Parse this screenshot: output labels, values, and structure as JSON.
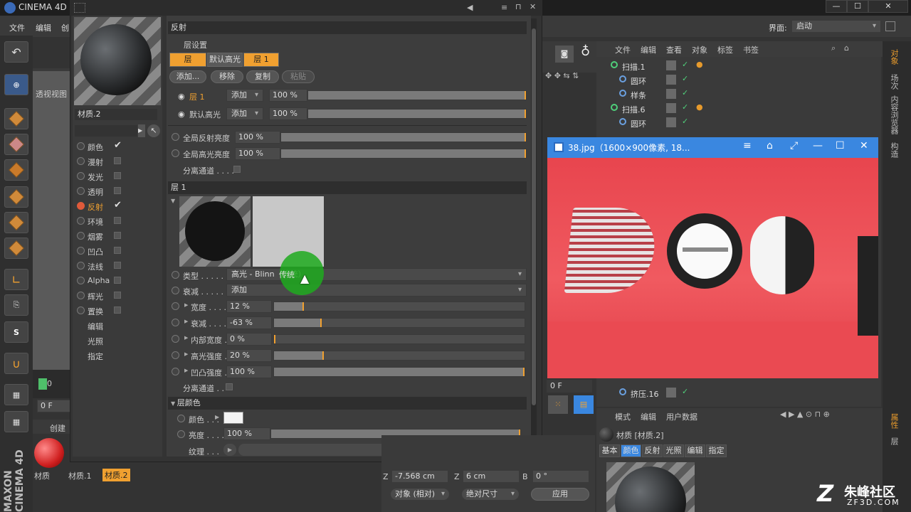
{
  "app": {
    "title": "CINEMA 4D",
    "menus": [
      "文件",
      "编辑",
      "创"
    ],
    "layout_label": "界面:",
    "layout_value": "启动"
  },
  "viewport": {
    "tab": "查看",
    "view_label": "透视视图",
    "frame_top": "0",
    "frame_field": "0 F"
  },
  "material_editor": {
    "preview_name": "材质.2",
    "channels": [
      {
        "label": "颜色",
        "checked": "✔",
        "active": false
      },
      {
        "label": "漫射",
        "checked": "",
        "active": false
      },
      {
        "label": "发光",
        "checked": "",
        "active": false
      },
      {
        "label": "透明",
        "checked": "",
        "active": false
      },
      {
        "label": "反射",
        "checked": "✔",
        "active": true
      },
      {
        "label": "环境",
        "checked": "",
        "active": false
      },
      {
        "label": "烟雾",
        "checked": "",
        "active": false
      },
      {
        "label": "凹凸",
        "checked": "",
        "active": false
      },
      {
        "label": "法线",
        "checked": "",
        "active": false
      },
      {
        "label": "Alpha",
        "checked": "",
        "active": false
      },
      {
        "label": "辉光",
        "checked": "",
        "active": false
      },
      {
        "label": "置换",
        "checked": "",
        "active": false
      }
    ],
    "extra": [
      "编辑",
      "光照",
      "指定"
    ],
    "reflection": {
      "title": "反射",
      "layer_settings": "层设置",
      "tabs": [
        "层",
        "默认高光",
        "层 1"
      ],
      "buttons": [
        "添加...",
        "移除",
        "复制",
        "粘贴"
      ],
      "layers": [
        {
          "name": "层 1",
          "mode": "添加",
          "value": "100 %"
        },
        {
          "name": "默认高光",
          "mode": "添加",
          "value": "100 %"
        }
      ],
      "global_reflect": {
        "label": "全局反射亮度",
        "value": "100 %"
      },
      "global_spec": {
        "label": "全局高光亮度",
        "value": "100 %"
      },
      "separate": "分离通道 . . . ."
    },
    "layer1": {
      "title": "层 1",
      "type_label": "类型 . . . . .",
      "type_value": "高光 - Blinn（传统）",
      "atten_label": "衰减 . . . . .",
      "atten_value": "添加",
      "params": [
        {
          "label": "宽度 . . . .",
          "value": "12 %",
          "fill": 0.12
        },
        {
          "label": "衰减 . . . .",
          "value": "-63 %",
          "fill": 0.19
        },
        {
          "label": "内部宽度 .",
          "value": "0 %",
          "fill": 0.0
        },
        {
          "label": "高光强度 .",
          "value": "20 %",
          "fill": 0.2
        },
        {
          "label": "凹凸强度 .",
          "value": "100 %",
          "fill": 1.0
        }
      ],
      "separate": "分离通道 . ."
    },
    "layer_color": {
      "title": "层颜色",
      "color_label": "颜色 . . .",
      "brightness_label": "亮度 . . . .",
      "brightness_value": "100 %",
      "texture_label": "纹理 . . ."
    }
  },
  "objects": {
    "menus": [
      "文件",
      "编辑",
      "查看",
      "对象",
      "标签",
      "书签"
    ],
    "items": [
      {
        "name": "扫描.1",
        "indent": 0
      },
      {
        "name": "圆环",
        "indent": 1
      },
      {
        "name": "样条",
        "indent": 1
      },
      {
        "name": "扫描.6",
        "indent": 0
      },
      {
        "name": "圆环",
        "indent": 1
      },
      {
        "name": "挤压.16",
        "indent": 1
      }
    ],
    "frame_field": "0 F"
  },
  "attributes": {
    "menus": [
      "模式",
      "编辑",
      "用户数据"
    ],
    "material_name": "材质 [材质.2]",
    "tabs": [
      "基本",
      "颜色",
      "反射",
      "光照",
      "编辑",
      "指定"
    ]
  },
  "image_viewer": {
    "title": "38.jpg（1600×900像素, 18...",
    "letters": "DOS"
  },
  "materials": {
    "tab": "创建",
    "items": [
      "材质",
      "材质.1",
      "材质.2"
    ]
  },
  "coords": {
    "z_label": "Z",
    "z_value": "-7.568 cm",
    "z2_label": "Z",
    "z2_value": "6 cm",
    "b_label": "B",
    "b_value": "0 °",
    "mode1": "对象 (相对)",
    "mode2": "绝对尺寸",
    "apply": "应用"
  },
  "right_tabs": [
    "对象",
    "场次",
    "内容浏览器",
    "构造"
  ],
  "right_tabs2": [
    "属性",
    "层"
  ],
  "watermark": {
    "brand": "朱峰社区",
    "url": "ZF3D.COM"
  }
}
